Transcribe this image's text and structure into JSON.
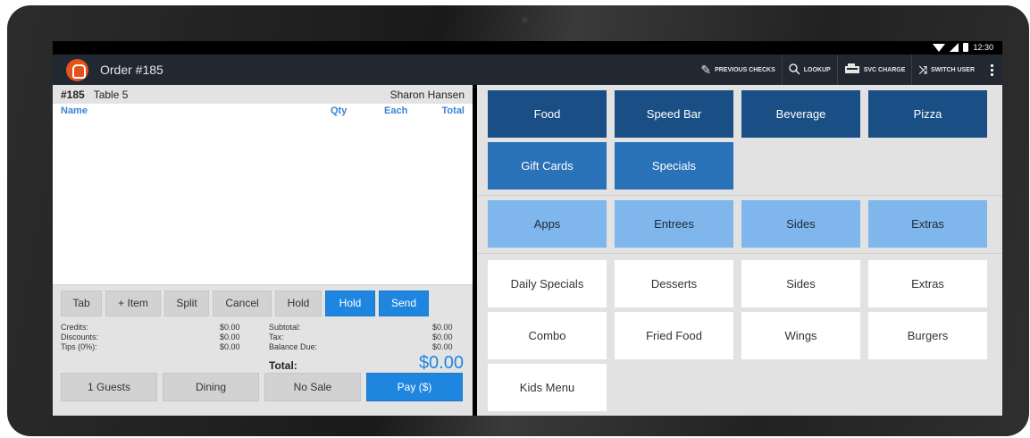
{
  "status_bar": {
    "time": "12:30"
  },
  "app_bar": {
    "order_title": "Order #185",
    "actions": [
      {
        "icon": "pen-icon",
        "label": "PREVIOUS CHECKS"
      },
      {
        "icon": "search-icon",
        "label": "LOOKUP"
      },
      {
        "icon": "register-icon",
        "label": "SVC CHARGE"
      },
      {
        "icon": "shuffle-icon",
        "label": "SWITCH USER"
      }
    ]
  },
  "order": {
    "number": "#185",
    "table": "Table 5",
    "server": "Sharon Hansen",
    "columns": {
      "name": "Name",
      "qty": "Qty",
      "each": "Each",
      "total": "Total"
    },
    "buttons": [
      "Tab",
      "+ Item",
      "Split",
      "Cancel",
      "Hold",
      "Hold",
      "Send"
    ],
    "totals": {
      "credits_label": "Credits:",
      "credits": "$0.00",
      "discounts_label": "Discounts:",
      "discounts": "$0.00",
      "tips_label": "Tips (0%):",
      "tips": "$0.00",
      "subtotal_label": "Subtotal:",
      "subtotal": "$0.00",
      "tax_label": "Tax:",
      "tax": "$0.00",
      "balance_label": "Balance Due:",
      "balance": "$0.00",
      "total_label": "Total:",
      "total": "$0.00"
    },
    "bottom_buttons": [
      "1 Guests",
      "Dining",
      "No Sale",
      "Pay ($)"
    ]
  },
  "menu": {
    "categories": [
      "Food",
      "Speed Bar",
      "Beverage",
      "Pizza",
      "Gift Cards",
      "Specials"
    ],
    "subcategories": [
      "Apps",
      "Entrees",
      "Sides",
      "Extras"
    ],
    "items": [
      "Daily Specials",
      "Desserts",
      "Sides",
      "Extras",
      "Combo",
      "Fried Food",
      "Wings",
      "Burgers",
      "Kids Menu"
    ]
  },
  "colors": {
    "accent": "#1f86e0",
    "appbar": "#222831",
    "category": "#1a4f86",
    "subcategory": "#7fb6ec",
    "logo": "#e5531c"
  }
}
